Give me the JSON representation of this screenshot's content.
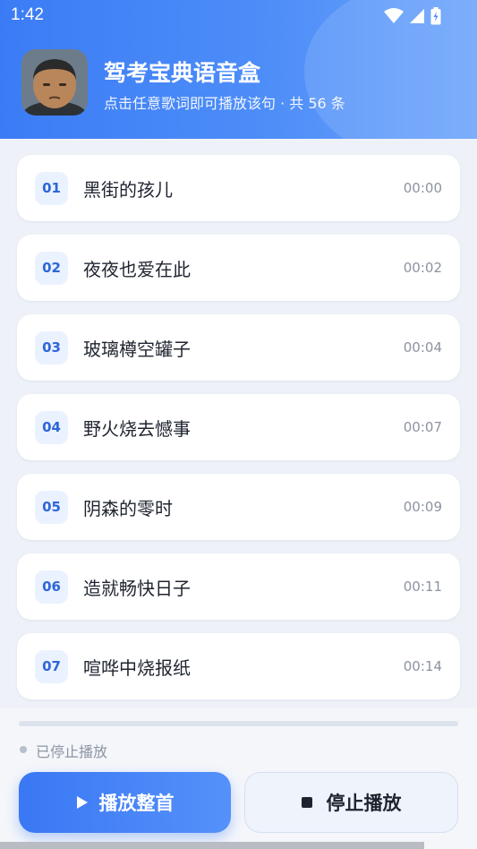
{
  "status_bar": {
    "time": "1:42"
  },
  "header": {
    "title": "驾考宝典语音盒",
    "subtitle": "点击任意歌词即可播放该句 · 共 56 条"
  },
  "lyrics": [
    {
      "num": "01",
      "text": "黑街的孩儿",
      "time": "00:00"
    },
    {
      "num": "02",
      "text": "夜夜也爱在此",
      "time": "00:02"
    },
    {
      "num": "03",
      "text": "玻璃樽空罐子",
      "time": "00:04"
    },
    {
      "num": "04",
      "text": "野火烧去憾事",
      "time": "00:07"
    },
    {
      "num": "05",
      "text": "阴森的零时",
      "time": "00:09"
    },
    {
      "num": "06",
      "text": "造就畅快日子",
      "time": "00:11"
    },
    {
      "num": "07",
      "text": "喧哗中烧报纸",
      "time": "00:14"
    }
  ],
  "player": {
    "progress": 0,
    "status": "已停止播放",
    "play_label": "播放整首",
    "stop_label": "停止播放"
  },
  "colors": {
    "accent": "#3b7cf6",
    "badge_bg": "#eaf1ff",
    "badge_text": "#2d66d8"
  }
}
